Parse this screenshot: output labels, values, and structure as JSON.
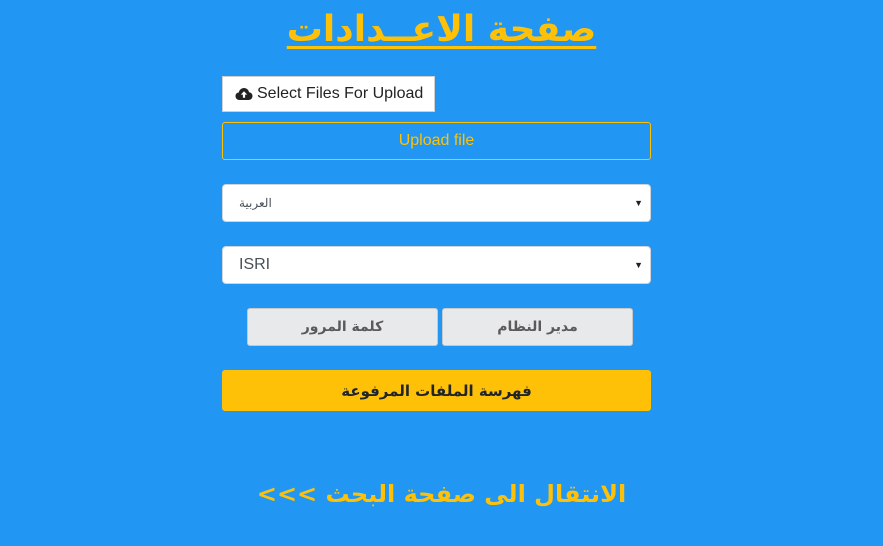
{
  "page": {
    "title": "صفحة الاعــدادات"
  },
  "upload": {
    "select_files_label": "Select Files For Upload",
    "select_files_icon": "cloud-upload-icon",
    "upload_button_label": "Upload file"
  },
  "settings": {
    "language_select_value": "العربية",
    "stemmer_select_value": "ISRI"
  },
  "buttons": {
    "password_label": "كلمة المرور",
    "admin_label": "مدير النظام",
    "index_label": "فهرسة الملفات المرفوعة"
  },
  "navigation": {
    "search_link_label": "الانتقال الى صفحة البحث >>>"
  },
  "colors": {
    "background": "#2196f3",
    "accent": "#ffc107"
  }
}
